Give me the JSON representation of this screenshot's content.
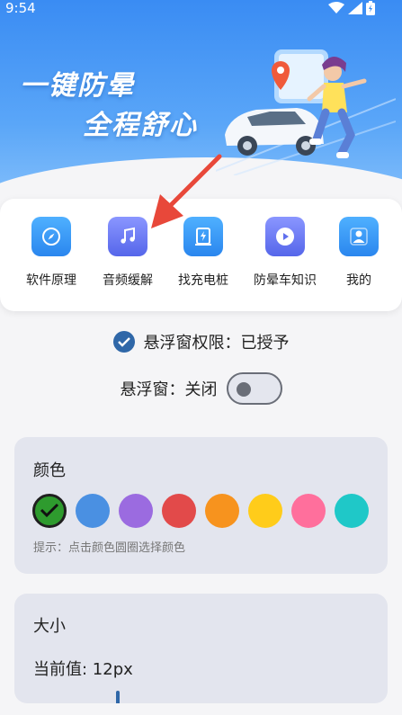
{
  "status_bar": {
    "time": "9:54"
  },
  "hero": {
    "line1": "一键防晕",
    "line2": "全程舒心"
  },
  "menu": [
    {
      "label": "软件原理",
      "icon": "compass-icon",
      "color": "#3d9bf3"
    },
    {
      "label": "音频缓解",
      "icon": "music-note-icon",
      "color": "#6f7cf2"
    },
    {
      "label": "找充电桩",
      "icon": "charging-station-icon",
      "color": "#3d9bf3"
    },
    {
      "label": "防晕车知识",
      "icon": "play-icon",
      "color": "#6f7cf2"
    },
    {
      "label": "我的",
      "icon": "person-icon",
      "color": "#3d9bf3"
    }
  ],
  "permission": {
    "text": "悬浮窗权限：已授予"
  },
  "floating_window": {
    "text": "悬浮窗：关闭",
    "enabled": false
  },
  "color_section": {
    "title": "颜色",
    "swatches": [
      "#2e9b2e",
      "#4a90e2",
      "#9b6be0",
      "#e24a4a",
      "#f7931e",
      "#ffcc1a",
      "#ff6f9c",
      "#1fc8c8"
    ],
    "selected_index": 0,
    "hint": "提示：点击颜色圆圈选择颜色"
  },
  "size_section": {
    "title": "大小",
    "current": "当前值: 12px"
  }
}
